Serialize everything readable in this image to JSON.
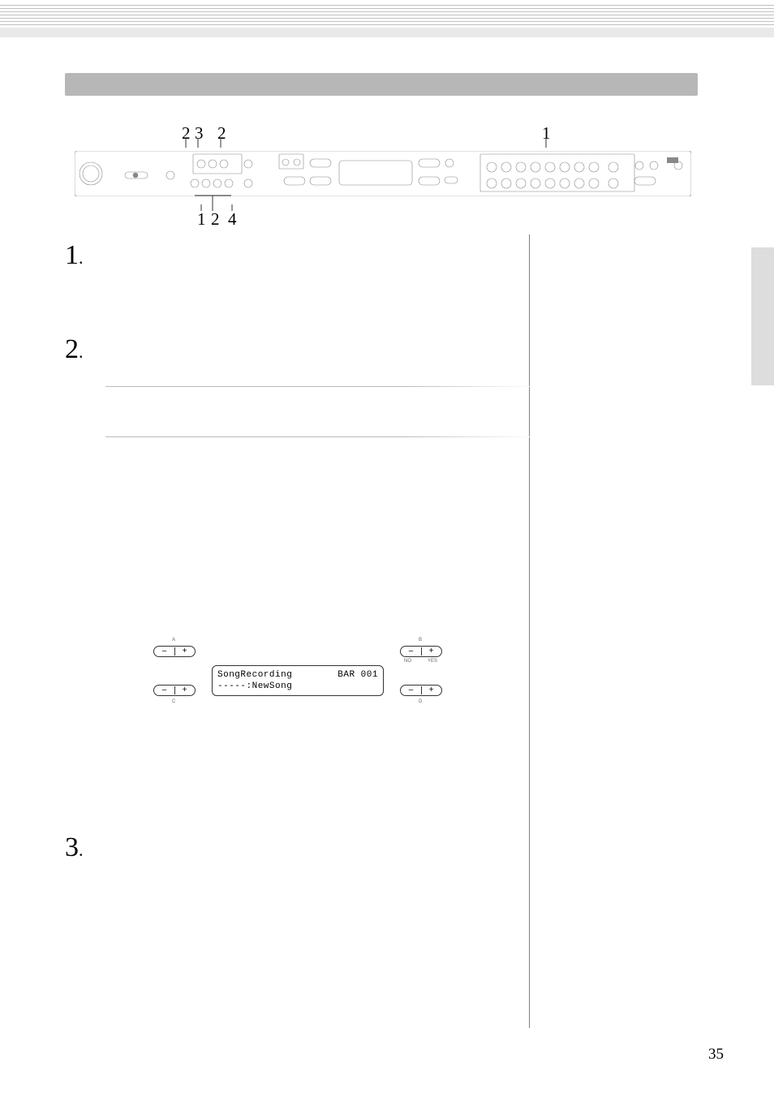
{
  "page_number": "35",
  "callouts": {
    "top_group": [
      "2",
      "3",
      "2"
    ],
    "top_right": "1",
    "bottom_group": [
      "1",
      "2",
      "4"
    ]
  },
  "steps": {
    "one": "1",
    "two": "2",
    "three": "3",
    "dot": "."
  },
  "lcd": {
    "line1_left": "SongRecording",
    "line1_right": "BAR 001",
    "line2": "-----:NewSong"
  },
  "pill_labels": {
    "A": "A",
    "B": "B",
    "C": "C",
    "D": "D",
    "NO": "NO",
    "YES": "YES"
  },
  "pill_signs": {
    "minus": "–",
    "plus": "+"
  }
}
